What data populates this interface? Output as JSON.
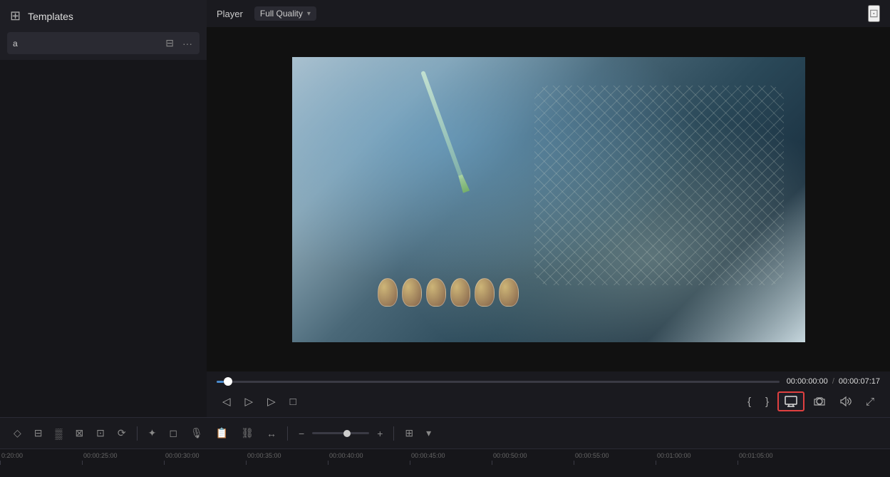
{
  "leftPanel": {
    "title": "Templates",
    "panelIconSymbol": "⊞",
    "searchPlaceholder": "a",
    "filterIconLabel": "filter-icon",
    "moreIconLabel": "more-icon"
  },
  "playerArea": {
    "playerLabel": "Player",
    "qualityLabel": "Full Quality",
    "monitorIconLabel": "monitor-icon",
    "timeCode": {
      "current": "00:00:00:00",
      "separator": "/",
      "total": "00:00:07:17"
    },
    "controls": {
      "stepBack": "◁",
      "stepForward": "▷",
      "play": "▷",
      "stop": "□",
      "inPoint": "{",
      "outPoint": "}",
      "monitor": "🖥",
      "camera": "📷",
      "audio": "🔊",
      "fullscreen": "⤢"
    }
  },
  "bottomToolbar": {
    "buttons": [
      {
        "name": "select-tool",
        "symbol": "◇"
      },
      {
        "name": "edit-tool",
        "symbol": "⊟"
      },
      {
        "name": "multicam-tool",
        "symbol": "▒"
      },
      {
        "name": "trim-tool",
        "symbol": "⊠"
      },
      {
        "name": "subtitle-tool",
        "symbol": "⊡"
      },
      {
        "name": "retime-tool",
        "symbol": "⟳"
      },
      {
        "name": "fx-tool",
        "symbol": "✦"
      },
      {
        "name": "mask-tool",
        "symbol": "◻"
      },
      {
        "name": "mic-tool",
        "symbol": "🎙"
      },
      {
        "name": "notes-tool",
        "symbol": "📋"
      },
      {
        "name": "scene-tool",
        "symbol": "⛓"
      },
      {
        "name": "audio-sync",
        "symbol": "↔"
      },
      {
        "name": "zoom-out",
        "symbol": "−"
      },
      {
        "name": "zoom-in",
        "symbol": "+"
      },
      {
        "name": "layout-icon",
        "symbol": "⊞"
      },
      {
        "name": "more-options",
        "symbol": "▾"
      }
    ]
  },
  "timeline": {
    "marks": [
      "0:20:00",
      "00:00:25:00",
      "00:00:30:00",
      "00:00:35:00",
      "00:00:40:00",
      "00:00:45:00",
      "00:00:50:00",
      "00:00:55:00",
      "00:01:00:00",
      "00:01:05:00"
    ]
  }
}
